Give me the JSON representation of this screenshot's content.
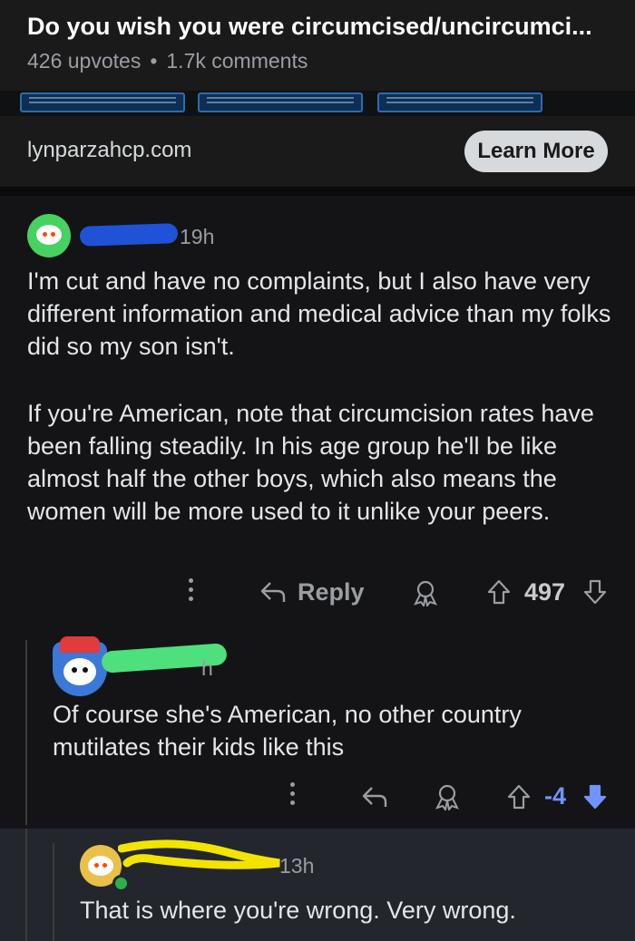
{
  "post": {
    "title": "Do you wish you were circumcised/uncircumci...",
    "upvotes": "426 upvotes",
    "separator": "•",
    "comments": "1.7k comments"
  },
  "ad": {
    "domain": "lynparzahcp.com",
    "cta_label": "Learn More"
  },
  "comments": [
    {
      "time": "19h",
      "paragraphs": [
        "I'm cut and have no complaints, but I also have very different information and medical advice than my folks did so my son isn't.",
        "If you're American, note that circumcision rates have been falling steadily. In his age group he'll be like almost half the other boys, which also means the women will be more used to it unlike your peers."
      ],
      "reply_label": "Reply",
      "score": "497",
      "colors": {
        "avatar": "#46d160",
        "scribble": "#1f52d6"
      }
    },
    {
      "time": "h",
      "text": "Of course she's American, no other country mutilates their kids like this",
      "score": "-4",
      "colors": {
        "scribble": "#4de07c",
        "downvote_active": "#7193ff"
      }
    },
    {
      "time": "13h",
      "text": "That is where you're wrong. Very wrong.",
      "colors": {
        "avatar": "#e9c04a",
        "scribble": "#f2e400",
        "online": "#2ab24a"
      }
    }
  ]
}
